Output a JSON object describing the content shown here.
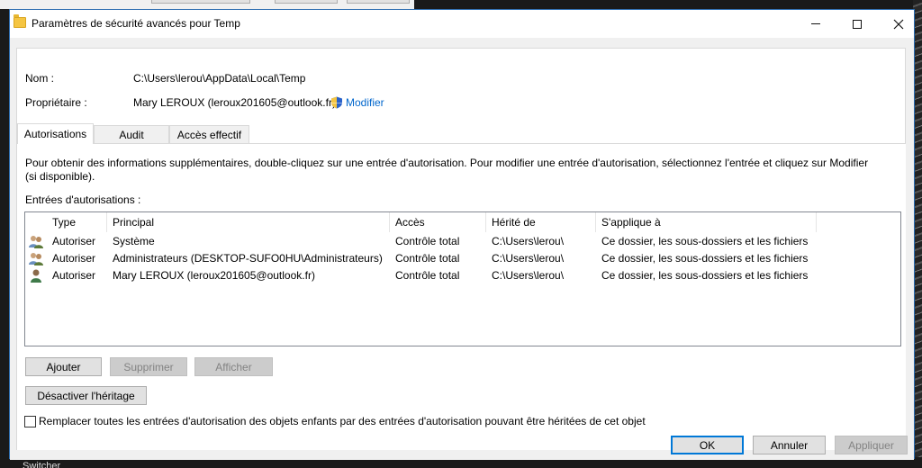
{
  "window": {
    "title": "Paramètres de sécurité avancés pour Temp"
  },
  "info": {
    "name_label": "Nom :",
    "name_value": "C:\\Users\\lerou\\AppData\\Local\\Temp",
    "owner_label": "Propriétaire :",
    "owner_value": "Mary LEROUX (leroux201605@outlook.fr)",
    "modify_link": "Modifier"
  },
  "tabs": [
    {
      "label": "Autorisations",
      "active": true
    },
    {
      "label": "Audit",
      "active": false
    },
    {
      "label": "Accès effectif",
      "active": false
    }
  ],
  "description": "Pour obtenir des informations supplémentaires, double-cliquez sur une entrée d'autorisation. Pour modifier une entrée d'autorisation, sélectionnez l'entrée et cliquez sur Modifier (si disponible).",
  "entries_label": "Entrées d'autorisations :",
  "table": {
    "columns": [
      "Type",
      "Principal",
      "Accès",
      "Hérité de",
      "S'applique à"
    ],
    "rows": [
      {
        "icon": "group-users-icon",
        "type": "Autoriser",
        "principal": "Système",
        "access": "Contrôle total",
        "inherited": "C:\\Users\\lerou\\",
        "applies": "Ce dossier, les sous-dossiers et les fichiers"
      },
      {
        "icon": "group-users-icon",
        "type": "Autoriser",
        "principal": "Administrateurs (DESKTOP-SUFO0HU\\Administrateurs)",
        "access": "Contrôle total",
        "inherited": "C:\\Users\\lerou\\",
        "applies": "Ce dossier, les sous-dossiers et les fichiers"
      },
      {
        "icon": "single-user-icon",
        "type": "Autoriser",
        "principal": "Mary LEROUX (leroux201605@outlook.fr)",
        "access": "Contrôle total",
        "inherited": "C:\\Users\\lerou\\",
        "applies": "Ce dossier, les sous-dossiers et les fichiers"
      }
    ]
  },
  "buttons": {
    "add": "Ajouter",
    "remove": "Supprimer",
    "view": "Afficher",
    "disable_inheritance": "Désactiver l'héritage",
    "ok": "OK",
    "cancel": "Annuler",
    "apply": "Appliquer"
  },
  "replace_checkbox": {
    "label": "Remplacer toutes les entrées d'autorisation des objets enfants par des entrées d'autorisation pouvant être héritées de cet objet",
    "checked": false
  },
  "background": {
    "taskbar_text": "Switcher"
  },
  "colors": {
    "link": "#0066cc",
    "accent": "#0078d7"
  }
}
